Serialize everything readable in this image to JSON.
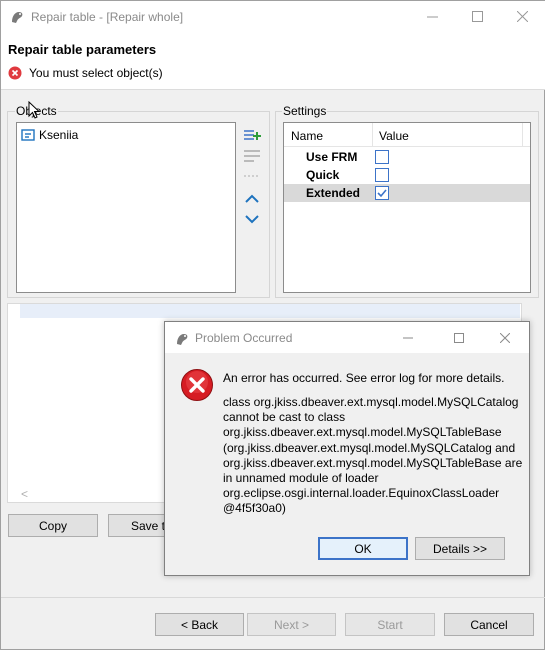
{
  "window": {
    "title": "Repair table - [Repair whole]",
    "header_title": "Repair table parameters",
    "error_message": "You must select object(s)"
  },
  "objects": {
    "label": "Objects",
    "items": [
      "Kseniia"
    ]
  },
  "settings": {
    "label": "Settings",
    "columns": [
      "Name",
      "Value"
    ],
    "rows": [
      {
        "name": "Use FRM",
        "checked": false
      },
      {
        "name": "Quick",
        "checked": false
      },
      {
        "name": "Extended",
        "checked": true
      }
    ]
  },
  "actions": {
    "copy": "Copy",
    "save": "Save ta"
  },
  "footer": {
    "back": "< Back",
    "next": "Next >",
    "start": "Start",
    "cancel": "Cancel"
  },
  "dialog": {
    "title": "Problem Occurred",
    "message": "An error has occurred. See error log for more details.",
    "details_lines": [
      "class org.jkiss.dbeaver.ext.mysql.model.MySQLCatalog",
      "cannot be cast to class",
      "org.jkiss.dbeaver.ext.mysql.model.MySQLTableBase",
      "(org.jkiss.dbeaver.ext.mysql.model.MySQLCatalog and",
      "org.jkiss.dbeaver.ext.mysql.model.MySQLTableBase are",
      "in unnamed module of loader",
      "org.eclipse.osgi.internal.loader.EquinoxClassLoader",
      "@4f5f30a0)"
    ],
    "ok": "OK",
    "details_button": "Details >>"
  },
  "colors": {
    "error_red": "#e0393e",
    "accent_blue": "#3c73c8",
    "add_green": "#2e9d3a"
  },
  "icons": {
    "app": "dbeaver-beaver-icon",
    "error": "error-x-icon",
    "table": "table-icon",
    "add": "add-icon",
    "remove": "remove-icon",
    "up": "chevron-up-icon",
    "down": "chevron-down-icon"
  }
}
